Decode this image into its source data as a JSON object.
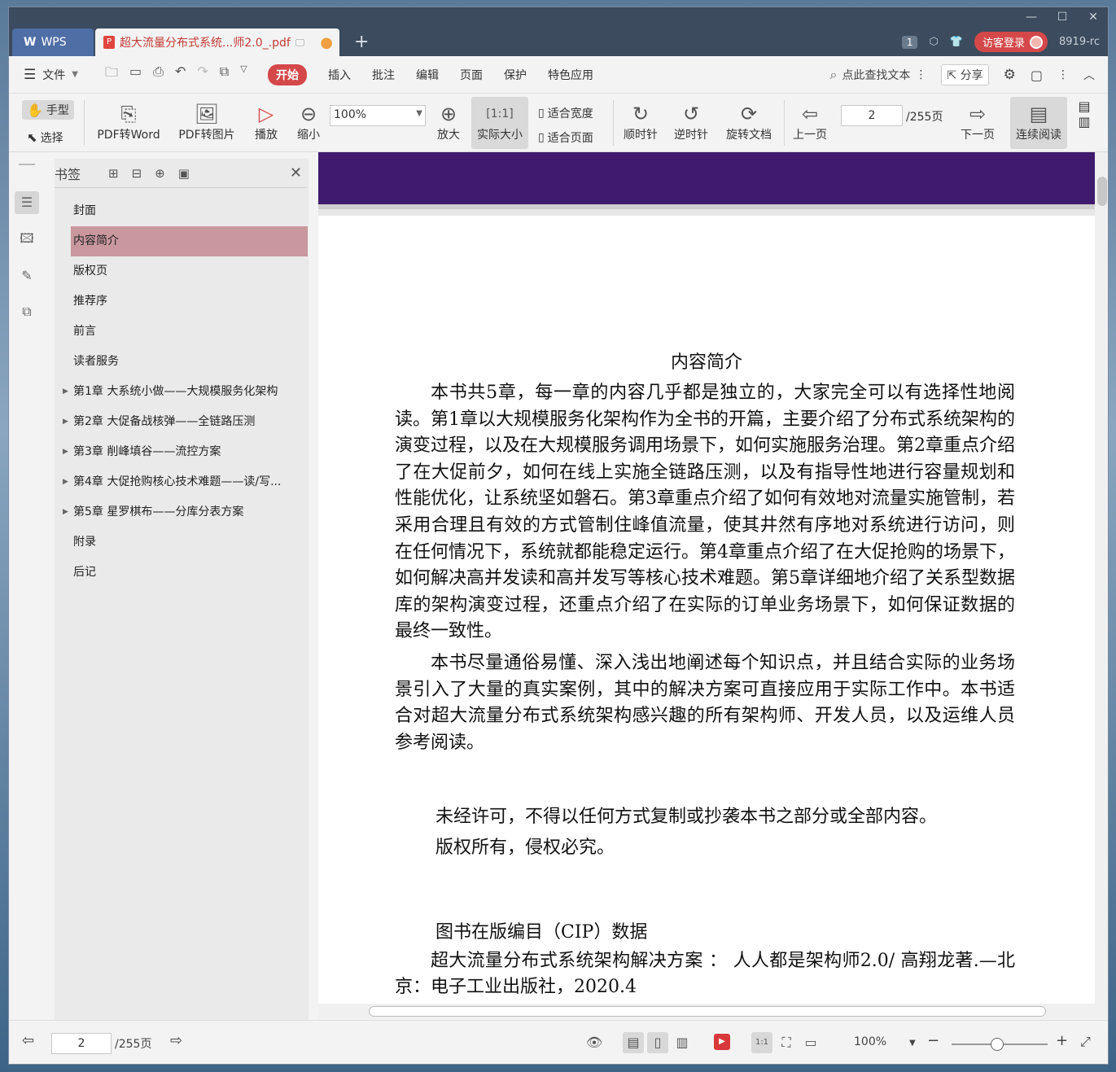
{
  "titlebar": {
    "app_tab": "WPS",
    "doc_tab": "超大流量分布式系统...师2.0_.pdf",
    "badge": "1",
    "login": "访客登录",
    "user_id": "8919-rc"
  },
  "menubar": {
    "file": "文件",
    "tabs": [
      "开始",
      "插入",
      "批注",
      "编辑",
      "页面",
      "保护",
      "特色应用"
    ],
    "search": "点此查找文本",
    "share": "分享"
  },
  "ribbon": {
    "hand": "手型",
    "select": "选择",
    "pdf_word": "PDF转Word",
    "pdf_image": "PDF转图片",
    "play": "播放",
    "zoom_out": "缩小",
    "zoom_value": "100%",
    "zoom_in": "放大",
    "actual_size": "实际大小",
    "fit_width": "适合宽度",
    "fit_page": "适合页面",
    "cw": "顺时针",
    "ccw": "逆时针",
    "rotate_doc": "旋转文档",
    "prev_page": "上一页",
    "page": "2",
    "total": "/255页",
    "next_page": "下一页",
    "continuous": "连续阅读"
  },
  "bookmarks": {
    "title": "书签",
    "items": [
      {
        "label": "封面",
        "expandable": false
      },
      {
        "label": "内容简介",
        "expandable": false
      },
      {
        "label": "版权页",
        "expandable": false
      },
      {
        "label": "推荐序",
        "expandable": false
      },
      {
        "label": "前言",
        "expandable": false
      },
      {
        "label": "读者服务",
        "expandable": false
      },
      {
        "label": "第1章 大系统小做——大规模服务化架构",
        "expandable": true
      },
      {
        "label": "第2章 大促备战核弹——全链路压测",
        "expandable": true
      },
      {
        "label": "第3章 削峰填谷——流控方案",
        "expandable": true
      },
      {
        "label": "第4章 大促抢购核心技术难题——读/写...",
        "expandable": true
      },
      {
        "label": "第5章 星罗棋布——分库分表方案",
        "expandable": true
      },
      {
        "label": "附录",
        "expandable": false
      },
      {
        "label": "后记",
        "expandable": false
      }
    ]
  },
  "document": {
    "title": "内容简介",
    "para1": "本书共5章，每一章的内容几乎都是独立的，大家完全可以有选择性地阅读。第1章以大规模服务化架构作为全书的开篇，主要介绍了分布式系统架构的演变过程，以及在大规模服务调用场景下，如何实施服务治理。第2章重点介绍了在大促前夕，如何在线上实施全链路压测，以及有指导性地进行容量规划和性能优化，让系统坚如磐石。第3章重点介绍了如何有效地对流量实施管制，若采用合理且有效的方式管制住峰值流量，使其井然有序地对系统进行访问，则在任何情况下，系统就都能稳定运行。第4章重点介绍了在大促抢购的场景下，如何解决高并发读和高并发写等核心技术难题。第5章详细地介绍了关系型数据库的架构演变过程，还重点介绍了在实际的订单业务场景下，如何保证数据的最终一致性。",
    "para2": "本书尽量通俗易懂、深入浅出地阐述每个知识点，并且结合实际的业务场景引入了大量的真实案例，其中的解决方案可直接应用于实际工作中。本书适合对超大流量分布式系统架构感兴趣的所有架构师、开发人员，以及运维人员参考阅读。",
    "notice1": "未经许可，不得以任何方式复制或抄袭本书之部分或全部内容。",
    "notice2": "版权所有，侵权必究。",
    "cip_title": "图书在版编目（CIP）数据",
    "cip_text": "超大流量分布式系统架构解决方案 ： 人人都是架构师2.0/ 高翔龙著.—北京：电子工业出版社，2020.4"
  },
  "statusbar": {
    "page": "2",
    "total": "/255页",
    "zoom": "100%"
  }
}
